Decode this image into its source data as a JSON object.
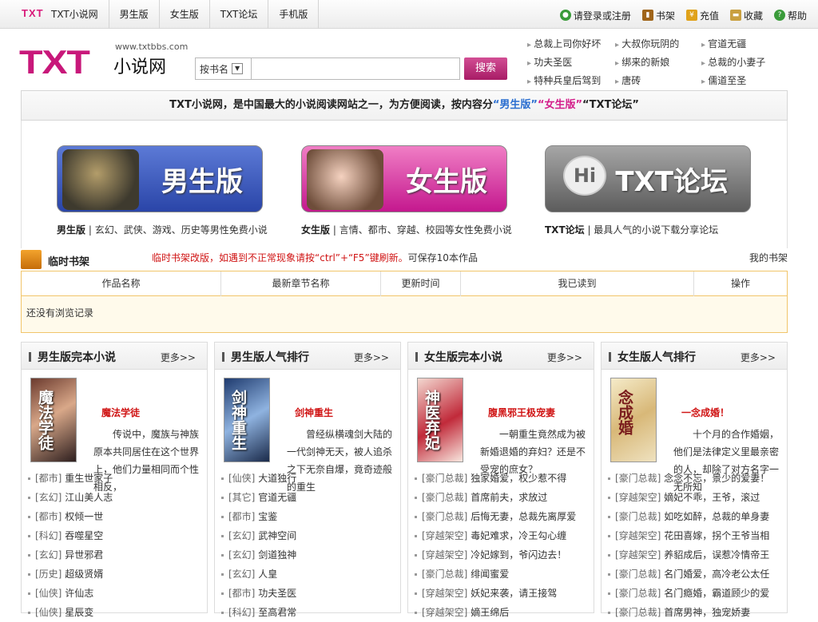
{
  "topbar": {
    "logo_text": "TXT",
    "nav": [
      "TXT小说网",
      "男生版",
      "女生版",
      "TXT论坛",
      "手机版"
    ],
    "user": {
      "login": "请登录或注册",
      "bookshelf": "书架",
      "recharge": "充值",
      "favorite": "收藏",
      "help": "帮助"
    }
  },
  "header": {
    "logo_letters": "TXT",
    "logo_cn": "小说网",
    "logo_url": "www.txtbbs.com",
    "search": {
      "type_label": "按书名",
      "placeholder": "",
      "button": "搜索"
    },
    "hotlinks": [
      "总裁上司你好坏",
      "大叔你玩阴的",
      "官道无疆",
      "功夫圣医",
      "绑来的新娘",
      "总裁的小妻子",
      "特种兵皇后驾到",
      "唐砖",
      "儒道至圣"
    ]
  },
  "banner": {
    "text": "TXT小说网，是中国最大的小说阅读网站之一，为方便阅读，按内容分",
    "boy": "“男生版”",
    "girl": "“女生版”",
    "forum": "“TXT论坛”"
  },
  "panels": [
    {
      "button": "男生版",
      "label": "男生版",
      "desc": "玄幻、武侠、游戏、历史等男性免费小说"
    },
    {
      "button": "女生版",
      "label": "女生版",
      "desc": "言情、都市、穿越、校园等女性免费小说"
    },
    {
      "button": "TXT论坛",
      "icon": "Hi",
      "label": "TXT论坛",
      "desc": "最具人气的小说下载分享论坛"
    }
  ],
  "shelf": {
    "title": "临时书架",
    "note": "临时书架改版，如遇到不正常现象请按“ctrl”+“F5”键刷新。",
    "note2": "可保存10本作品",
    "my_shelf": "我的书架",
    "columns": [
      "作品名称",
      "最新章节名称",
      "更新时间",
      "我已读到",
      "操作"
    ],
    "empty": "还没有浏览记录"
  },
  "boxes": [
    {
      "title": "男生版完本小说",
      "more": "更多>>",
      "featured": {
        "title": "魔法学徒",
        "cover_text": "魔法学徒",
        "desc": "传说中，魔族与神族原本共同居住在这个世界上，他们力量相同而个性相反，"
      },
      "items": [
        [
          "[都市]",
          "重生世家子"
        ],
        [
          "[玄幻]",
          "江山美人志"
        ],
        [
          "[都市]",
          "权倾一世"
        ],
        [
          "[科幻]",
          "吞噬星空"
        ],
        [
          "[玄幻]",
          "异世邪君"
        ],
        [
          "[历史]",
          "超级贤婿"
        ],
        [
          "[仙侠]",
          "许仙志"
        ],
        [
          "[仙侠]",
          "星辰变"
        ]
      ]
    },
    {
      "title": "男生版人气排行",
      "more": "更多>>",
      "featured": {
        "title": "剑神重生",
        "cover_text": "剑神重生",
        "desc": "曾经纵横魂剑大陆的一代剑神无天，被人追杀之下无奈自爆，竟奇迹般的重生"
      },
      "items": [
        [
          "[仙侠]",
          "大道独行"
        ],
        [
          "[其它]",
          "官道无疆"
        ],
        [
          "[都市]",
          "宝鉴"
        ],
        [
          "[玄幻]",
          "武神空间"
        ],
        [
          "[玄幻]",
          "剑道独神"
        ],
        [
          "[玄幻]",
          "人皇"
        ],
        [
          "[都市]",
          "功夫圣医"
        ],
        [
          "[科幻]",
          "至高君常"
        ]
      ]
    },
    {
      "title": "女生版完本小说",
      "more": "更多>>",
      "featured": {
        "title": "腹黑邪王极宠妻",
        "cover_text": "神医弃妃",
        "desc": "一朝重生竟然成为被新婚退婚的弃妇？还是不受宠的庶女？"
      },
      "items": [
        [
          "[豪门总裁]",
          "独家婚爱，权少惹不得"
        ],
        [
          "[豪门总裁]",
          "首席前夫，求放过"
        ],
        [
          "[豪门总裁]",
          "后悔无妻，总裁先离厚爱"
        ],
        [
          "[穿越架空]",
          "毒妃难求，冷王勾心缠"
        ],
        [
          "[穿越架空]",
          "冷妃嫁到，爷闪边去！"
        ],
        [
          "[豪门总裁]",
          "绯闻蜜爱"
        ],
        [
          "[穿越架空]",
          "妖妃来袭，请王接驾"
        ],
        [
          "[穿越架空]",
          "嫡王绵后"
        ]
      ]
    },
    {
      "title": "女生版人气排行",
      "more": "更多>>",
      "featured": {
        "title": "一念成婚！",
        "cover_text": "念成婚",
        "desc": "十个月的合作婚姻，他们是法律定义里最亲密的人，却除了对方名字一无所知"
      },
      "items": [
        [
          "[豪门总裁]",
          "念念不忘，景少的爱妻！"
        ],
        [
          "[穿越架空]",
          "嫡妃不乖，王爷，滚过"
        ],
        [
          "[豪门总裁]",
          "如吃如醉，总裁的单身妻"
        ],
        [
          "[穿越架空]",
          "花田喜嫁，拐个王爷当相"
        ],
        [
          "[穿越架空]",
          "养貂成后，误惹冷情帝王"
        ],
        [
          "[豪门总裁]",
          "名门婚爱，高冷老公太任"
        ],
        [
          "[豪门总裁]",
          "名门瘾婚，霸道顾少的爱"
        ],
        [
          "[豪门总裁]",
          "首席男神，独宠娇妻"
        ]
      ]
    }
  ],
  "colors": {
    "brand_pink": "#c8187a",
    "alert_red": "#d01515",
    "boy_blue": "#2a6ed0",
    "girl_pink": "#d31d8a"
  }
}
